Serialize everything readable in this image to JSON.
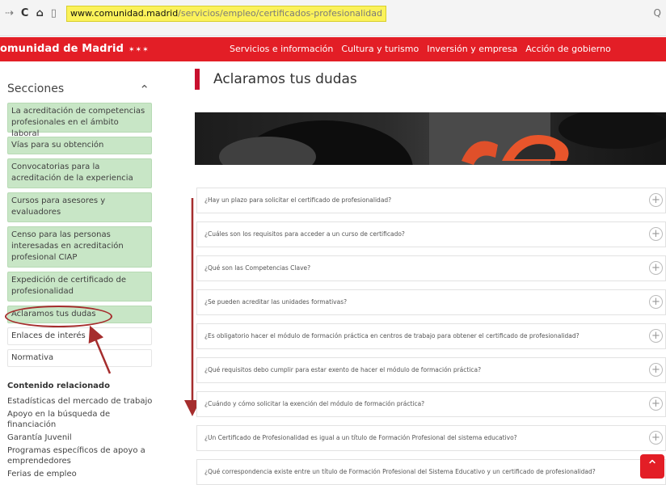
{
  "browser": {
    "url_host": "www.comunidad.madrid",
    "url_path": "/servicios/empleo/certificados-profesionalidad",
    "nav_back": "⇢",
    "nav_reload": "C",
    "nav_home": "⌂",
    "zoom": "Q"
  },
  "header": {
    "logo_text": "omunidad de Madrid",
    "logo_stars": "✶✶✶",
    "nav": [
      "Servicios e información",
      "Cultura y turismo",
      "Inversión y empresa",
      "Acción de gobierno"
    ]
  },
  "sidebar": {
    "title": "Secciones",
    "toggle": "⌃",
    "items": [
      "La acreditación de competencias profesionales en el ámbito laboral",
      "Vías para su obtención",
      "Convocatorias para la acreditación de la experiencia",
      "Cursos para asesores y evaluadores",
      "Censo para las personas interesadas en acreditación profesional CIAP",
      "Expedición de certificado de profesionalidad",
      "Aclaramos tus dudas",
      "Enlaces de interés",
      "Normativa"
    ],
    "related_title": "Contenido relacionado",
    "related": [
      "Estadísticas del mercado de trabajo",
      "Apoyo en la búsqueda de financiación",
      "Garantía Juvenil",
      "Programas específicos de apoyo a emprendedores",
      "Ferias de empleo"
    ]
  },
  "main": {
    "title": "Aclaramos tus dudas",
    "faqs": [
      "¿Hay un plazo para solicitar el certificado de profesionalidad?",
      "¿Cuáles son los requisitos para acceder a un curso de certificado?",
      "¿Qué son las Competencias Clave?",
      "¿Se pueden acreditar las unidades formativas?",
      "¿Es obligatorio hacer el módulo de formación práctica en centros de trabajo para obtener el certificado de profesionalidad?",
      "¿Qué requisitos debo cumplir para estar exento de hacer el módulo de formación práctica?",
      "¿Cuándo y cómo solicitar la exención del módulo de formación práctica?",
      "¿Un Certificado de Profesionalidad es igual a un título de Formación Profesional del sistema educativo?",
      "¿Qué correspondencia existe entre un título de Formación Profesional del Sistema Educativo y un certificado de profesionalidad?"
    ],
    "expand_symbol": "+",
    "to_top_symbol": "⌃"
  },
  "colors": {
    "brand_red": "#e31e26",
    "section_green": "#c8e6c6",
    "annotation": "#a52d2d",
    "url_highlight": "#fbf25a"
  }
}
